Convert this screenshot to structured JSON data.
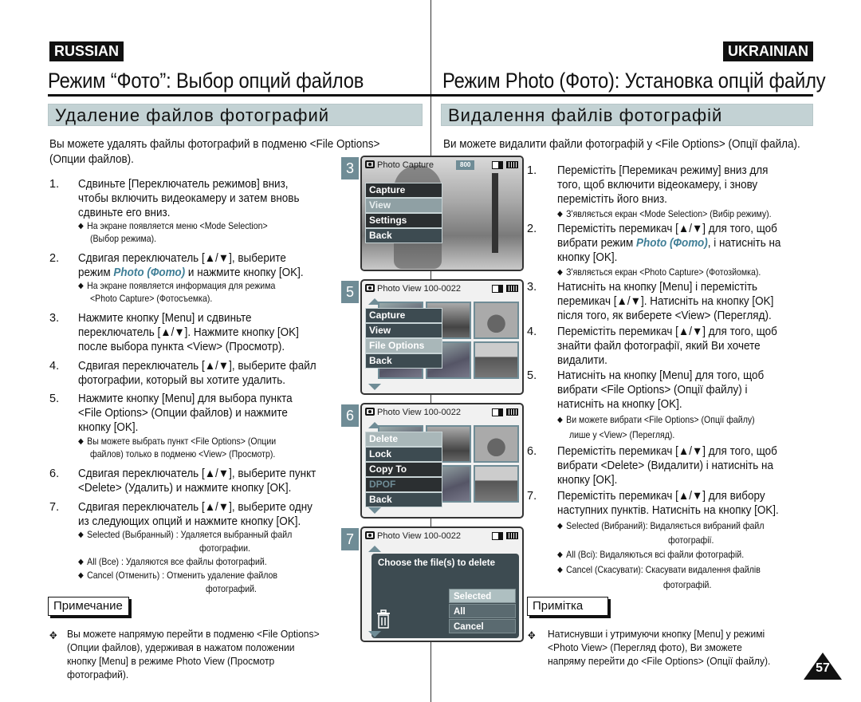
{
  "left": {
    "language": "RUSSIAN",
    "title": "Режим “Фото”: Выбор опций файлов",
    "section": "Удаление файлов фотографий",
    "intro_1": "Вы можете удалять файлы фотографий в подменю <File Options>",
    "intro_2": "(Опции файлов).",
    "steps": [
      {
        "num": "1.",
        "lines": [
          "Сдвиньте [Переключатель режимов] вниз,",
          "чтобы включить видеокамеру и затем вновь",
          "сдвиньте его вниз."
        ],
        "notes": [
          "На экране появляется меню <Mode Selection>",
          "(Выбор режима)."
        ]
      },
      {
        "num": "2.",
        "lines": [
          "Сдвигая переключатель [▲/▼], выберите"
        ],
        "line2_pre": "режим ",
        "line2_em": "Photo (Фото)",
        "line2_post": " и нажмите кнопку [OK].",
        "notes": [
          "На экране появляется информация для режима",
          "<Photo Capture> (Фотосъемка)."
        ]
      },
      {
        "num": "3.",
        "lines": [
          "Нажмите кнопку [Menu] и сдвиньте",
          "переключатель [▲/▼]. Нажмите кнопку [OK]",
          "после выбора пункта <View> (Просмотр)."
        ]
      },
      {
        "num": "4.",
        "lines": [
          "Сдвигая переключатель [▲/▼], выберите файл",
          "фотографии, который вы хотите удалить."
        ]
      },
      {
        "num": "5.",
        "lines": [
          "Нажмите кнопку [Menu] для выбора пункта",
          "<File Options> (Опции файлов) и нажмите",
          "кнопку [OK]."
        ],
        "notes": [
          "Вы можете выбрать пункт <File Options> (Опции",
          "файлов) только в подменю <View> (Просмотр)."
        ]
      },
      {
        "num": "6.",
        "lines": [
          "Сдвигая переключатель [▲/▼], выберите пункт",
          "<Delete> (Удалить) и нажмите кнопку [OK]."
        ]
      },
      {
        "num": "7.",
        "lines": [
          "Сдвигая переключатель [▲/▼], выберите одну",
          "из следующих опций и нажмите кнопку [OK]."
        ],
        "notes": [
          "Selected (Выбранный) : Удаляется выбранный файл",
          "фотографии.",
          "All (Все) : Удаляются все файлы фотографий.",
          "Cancel (Отменить) : Отменить удаление файлов",
          "фотографий."
        ]
      }
    ],
    "note_label": "Примечание",
    "note_lines": [
      "Вы можете напрямую перейти в подменю <File Options>",
      "(Опции файлов), удерживая в нажатом положении",
      "кнопку [Menu] в режиме Photo View (Просмотр",
      "фотографий)."
    ]
  },
  "right": {
    "language": "UKRAINIAN",
    "title": "Режим Photo (Фото): Установка опцій файлу",
    "section": "Видалення файлів фотографій",
    "intro": "Ви можете видалити файли фотографій у <File Options> (Опції файла).",
    "steps": [
      {
        "num": "1.",
        "lines": [
          "Перемістіть [Перемикач режиму] вниз для",
          "того, щоб включити відеокамеру, і знову",
          "перемістіть його вниз."
        ],
        "notes": [
          "З'являється екран <Mode Selection> (Вибір режиму)."
        ]
      },
      {
        "num": "2.",
        "lines": [
          "Перемістіть перемикач [▲/▼] для того, щоб"
        ],
        "line2_pre": "вибрати режим ",
        "line2_em": "Photo (Фото)",
        "line2_post": ", і натисніть на",
        "line3": "кнопку [OK].",
        "notes": [
          "З'являється екран <Photo Capture> (Фотозйомка)."
        ]
      },
      {
        "num": "3.",
        "lines": [
          "Натисніть на кнопку [Menu] і перемістіть",
          "перемикач [▲/▼]. Натисніть на кнопку [OK]",
          "після того, як виберете <View> (Перегляд)."
        ]
      },
      {
        "num": "4.",
        "lines": [
          "Перемістіть перемикач [▲/▼] для того, щоб",
          "знайти файл фотографії, який Ви хочете",
          "видалити."
        ]
      },
      {
        "num": "5.",
        "lines": [
          "Натисніть на кнопку [Menu] для того, щоб",
          "вибрати <File Options> (Опції файлу) і",
          "натисніть на кнопку [OK]."
        ],
        "notes": [
          "Ви можете вибрати <File Options> (Опції файлу)",
          "лише у <View> (Перегляд)."
        ]
      },
      {
        "num": "6.",
        "lines": [
          "Перемістіть перемикач [▲/▼] для того, щоб",
          "вибрати <Delete> (Видалити) і натисніть на",
          "кнопку [OK]."
        ]
      },
      {
        "num": "7.",
        "lines": [
          "Перемістіть перемикач [▲/▼] для вибору",
          "наступних пунктів. Натисніть на кнопку [OK]."
        ],
        "notes": [
          "Selected (Вибраний): Видаляється вибраний файл",
          "фотографії.",
          "All (Всі): Видаляються всі файли фотографій.",
          "Cancel (Скасувати): Скасувати видалення файлів",
          "фотографій."
        ]
      }
    ],
    "note_label": "Примітка",
    "note_lines": [
      "Натиснувши і утримуючи кнопку [Menu] у режимі",
      "<Photo View> (Перегляд фото), Ви зможете",
      "напряму перейти до <File Options> (Опції файлу)."
    ]
  },
  "screens": [
    {
      "step": "3",
      "header": "Photo Capture",
      "badge": "800",
      "menu": [
        "Capture",
        "View",
        "Settings",
        "Back"
      ]
    },
    {
      "step": "5",
      "header": "Photo View  100-0022",
      "menu": [
        "Capture",
        "View",
        "File Options",
        "Back"
      ]
    },
    {
      "step": "6",
      "header": "Photo View  100-0022",
      "menu": [
        "Delete",
        "Lock",
        "Copy To",
        "DPOF",
        "Back"
      ]
    },
    {
      "step": "7",
      "header": "Photo View  100-0022",
      "dialog_title": "Choose the file(s) to delete",
      "options": [
        "Selected",
        "All",
        "Cancel"
      ]
    }
  ],
  "page_number": "57",
  "colors": {
    "accent": "#6f8c96",
    "section_bg": "#c3d2d4",
    "menu_bg": "#3d4b51",
    "italic_photo": "#3f7e96"
  }
}
